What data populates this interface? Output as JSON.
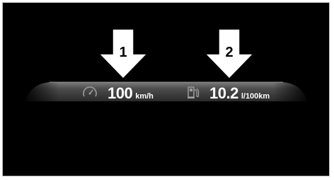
{
  "display": {
    "speed": {
      "value": "100",
      "unit": "km/h",
      "icon": "speedometer-icon"
    },
    "consumption": {
      "value": "10.2",
      "unit": "l/100km",
      "icon": "fuel-pump-icon"
    }
  },
  "callouts": [
    {
      "label": "1"
    },
    {
      "label": "2"
    }
  ],
  "colors": {
    "background": "#000000",
    "bar": "#4a4a4a",
    "text": "#ffffff",
    "arrow": "#ffffff"
  }
}
